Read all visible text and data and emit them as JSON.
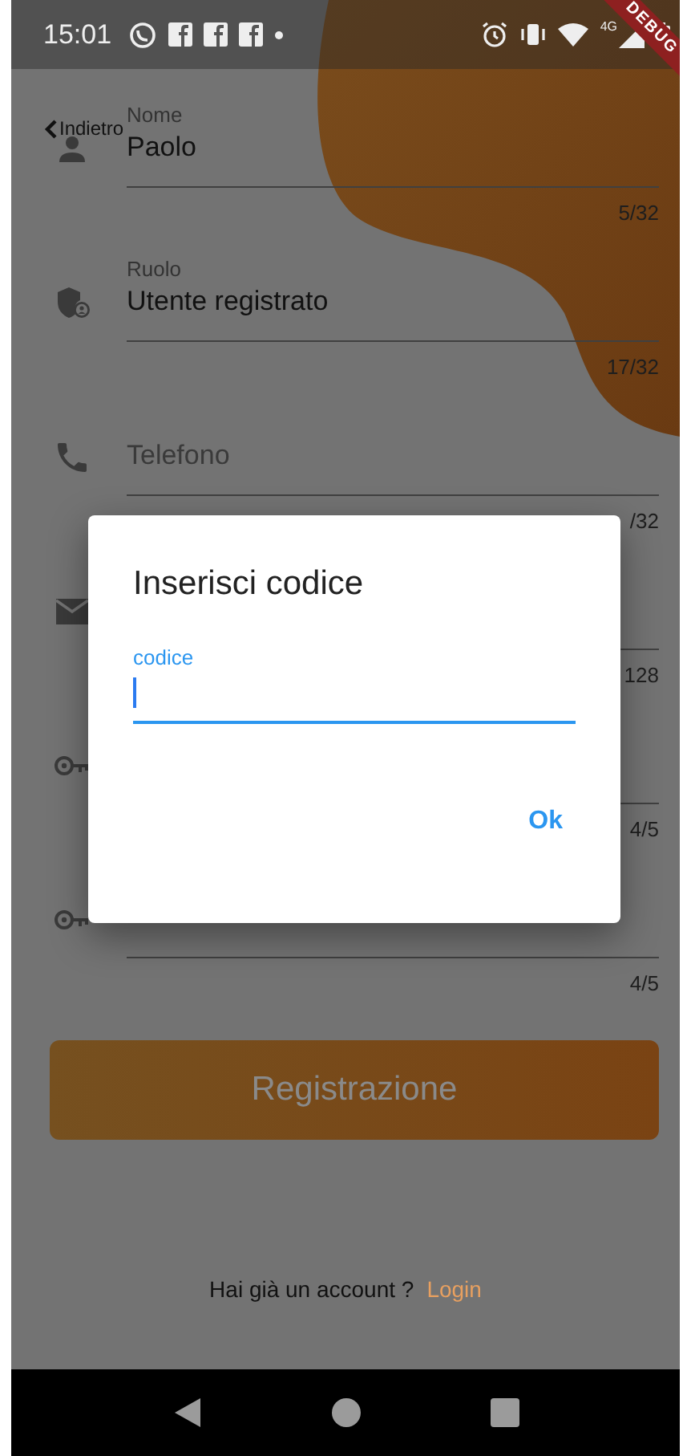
{
  "status_bar": {
    "time": "15:01",
    "network": "4G"
  },
  "debug_banner": "DEBUG",
  "back_button": {
    "label": "Indietro"
  },
  "fields": [
    {
      "label": "Nome",
      "value": "Paolo",
      "counter": "5/32"
    },
    {
      "label": "Ruolo",
      "value": "Utente registrato",
      "counter": "17/32"
    },
    {
      "placeholder": "Telefono",
      "counter": "/32"
    },
    {
      "counter": "128"
    },
    {
      "counter": "4/5"
    },
    {
      "counter": "4/5"
    }
  ],
  "register_button": "Registrazione",
  "footer": {
    "text": "Hai già un account ?",
    "link": "Login"
  },
  "dialog": {
    "title": "Inserisci codice",
    "field": {
      "label": "codice",
      "focused": true
    },
    "button": "Ok"
  }
}
